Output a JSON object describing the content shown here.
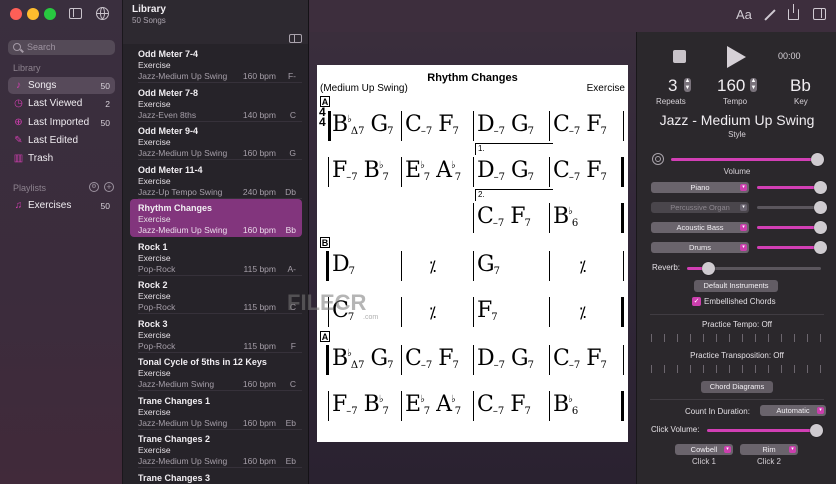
{
  "sidebar": {
    "search_placeholder": "Search",
    "library_header": "Library",
    "items": [
      {
        "label": "Songs",
        "count": "50",
        "icon": "music-note-icon"
      },
      {
        "label": "Last Viewed",
        "count": "2",
        "icon": "clock-icon"
      },
      {
        "label": "Last Imported",
        "count": "50",
        "icon": "import-icon"
      },
      {
        "label": "Last Edited",
        "count": "",
        "icon": "edit-icon"
      },
      {
        "label": "Trash",
        "count": "",
        "icon": "trash-icon"
      }
    ],
    "playlists_header": "Playlists",
    "playlists": [
      {
        "label": "Exercises",
        "count": "50",
        "icon": "playlist-icon"
      }
    ]
  },
  "list": {
    "title": "Library",
    "subtitle": "50 Songs",
    "songs": [
      {
        "title": "Odd Meter 7-4",
        "sub": "Exercise",
        "style": "Jazz-Medium Up Swing",
        "bpm": "160 bpm",
        "key": "F-"
      },
      {
        "title": "Odd Meter 7-8",
        "sub": "Exercise",
        "style": "Jazz-Even 8ths",
        "bpm": "140 bpm",
        "key": "C"
      },
      {
        "title": "Odd Meter 9-4",
        "sub": "Exercise",
        "style": "Jazz-Medium Up Swing",
        "bpm": "160 bpm",
        "key": "G"
      },
      {
        "title": "Odd Meter 11-4",
        "sub": "Exercise",
        "style": "Jazz-Up Tempo Swing",
        "bpm": "240 bpm",
        "key": "Db"
      },
      {
        "title": "Rhythm Changes",
        "sub": "Exercise",
        "style": "Jazz-Medium Up Swing",
        "bpm": "160 bpm",
        "key": "Bb"
      },
      {
        "title": "Rock 1",
        "sub": "Exercise",
        "style": "Pop-Rock",
        "bpm": "115 bpm",
        "key": "A-"
      },
      {
        "title": "Rock 2",
        "sub": "Exercise",
        "style": "Pop-Rock",
        "bpm": "115 bpm",
        "key": "C"
      },
      {
        "title": "Rock 3",
        "sub": "Exercise",
        "style": "Pop-Rock",
        "bpm": "115 bpm",
        "key": "F"
      },
      {
        "title": "Tonal Cycle of 5ths in 12 Keys",
        "sub": "Exercise",
        "style": "Jazz-Medium Swing",
        "bpm": "160 bpm",
        "key": "C"
      },
      {
        "title": "Trane Changes 1",
        "sub": "Exercise",
        "style": "Jazz-Medium Up Swing",
        "bpm": "160 bpm",
        "key": "Eb"
      },
      {
        "title": "Trane Changes 2",
        "sub": "Exercise",
        "style": "Jazz-Medium Up Swing",
        "bpm": "160 bpm",
        "key": "Eb"
      },
      {
        "title": "Trane Changes 3",
        "sub": "",
        "style": "",
        "bpm": "",
        "key": ""
      }
    ]
  },
  "toolbar": {
    "font_label": "Aa"
  },
  "score": {
    "title": "Rhythm Changes",
    "style": "(Medium Up Swing)",
    "composer": "Exercise",
    "section_a": "A",
    "section_b": "B",
    "time_sig_top": "4",
    "time_sig_bottom": "4",
    "ending_1": "1.",
    "ending_2": "2.",
    "watermark": "FILECR",
    "watermark_sub": ".com"
  },
  "player": {
    "time": "00:00",
    "repeats_value": "3",
    "repeats_label": "Repeats",
    "tempo_value": "160",
    "tempo_label": "Tempo",
    "key_value": "Bb",
    "key_label": "Key",
    "style_value": "Jazz - Medium Up Swing",
    "style_label": "Style",
    "volume_label": "Volume",
    "instruments": [
      {
        "name": "Piano",
        "enabled": true,
        "level": 0.98
      },
      {
        "name": "Percussive Organ",
        "enabled": false,
        "level": 0.98
      },
      {
        "name": "Acoustic Bass",
        "enabled": true,
        "level": 0.98
      },
      {
        "name": "Drums",
        "enabled": true,
        "level": 0.98
      }
    ],
    "master_volume": 0.97,
    "reverb_label": "Reverb:",
    "reverb_level": 0.16,
    "default_instruments": "Default Instruments",
    "embellished_chords": "Embellished Chords",
    "practice_tempo": "Practice Tempo: Off",
    "practice_transposition": "Practice Transposition: Off",
    "chord_diagrams": "Chord Diagrams",
    "count_in_label": "Count In Duration:",
    "count_in_value": "Automatic",
    "click_volume_label": "Click Volume:",
    "click_volume": 0.96,
    "click1_value": "Cowbell",
    "click1_label": "Click 1",
    "click2_value": "Rim",
    "click2_label": "Click 2"
  }
}
